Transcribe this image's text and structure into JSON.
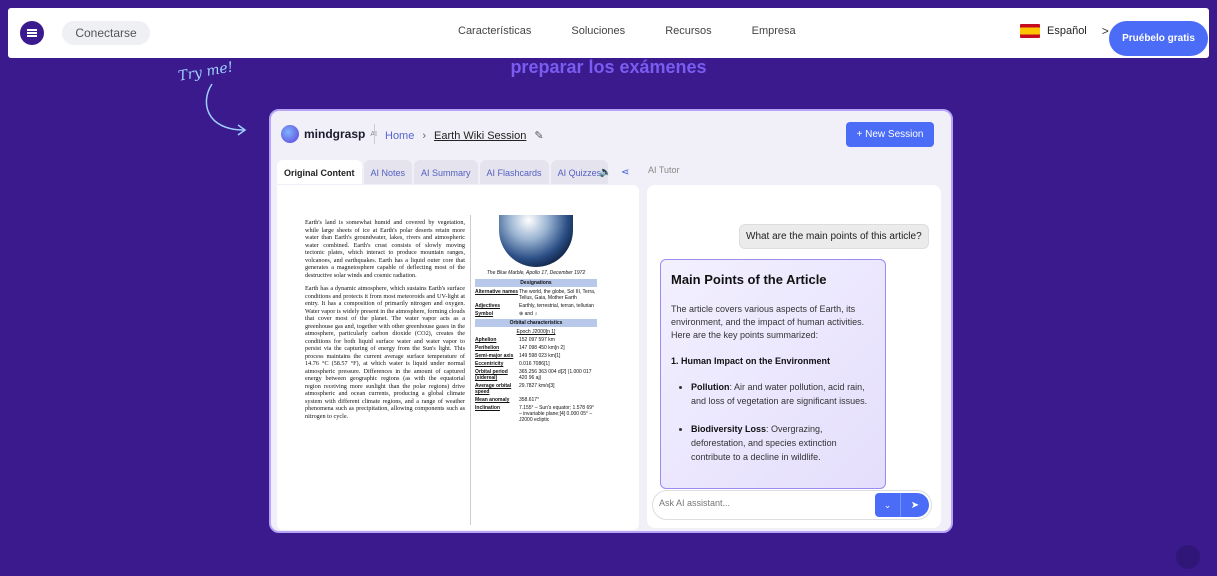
{
  "nav": {
    "login": "Conectarse",
    "links": [
      "Características",
      "Soluciones",
      "Recursos",
      "Empresa"
    ],
    "language": "Español",
    "cta": "Pruébelo gratis"
  },
  "hero": {
    "headline": "preparar los exámenes",
    "tryme": "Try me!"
  },
  "app": {
    "logo": "mindgrasp",
    "logo_sup": "AI",
    "breadcrumb_home": "Home",
    "breadcrumb_session": "Earth Wiki Session",
    "new_session": "+ New Session",
    "tabs": [
      "Original Content",
      "AI Notes",
      "AI Summary",
      "AI Flashcards",
      "AI Quizzes"
    ],
    "ai_tutor_label": "AI Tutor"
  },
  "document": {
    "para1": "Earth's land is somewhat humid and covered by vegetation, while large sheets of ice at Earth's polar deserts retain more water than Earth's groundwater, lakes, rivers and atmospheric water combined. Earth's crust consists of slowly moving tectonic plates, which interact to produce mountain ranges, volcanoes, and earthquakes. Earth has a liquid outer core that generates a magnetosphere capable of deflecting most of the destructive solar winds and cosmic radiation.",
    "para2": "Earth has a dynamic atmosphere, which sustains Earth's surface conditions and protects it from most meteoroids and UV-light at entry. It has a composition of primarily nitrogen and oxygen. Water vapor is widely present in the atmosphere, forming clouds that cover most of the planet. The water vapor acts as a greenhouse gas and, together with other greenhouse gases in the atmosphere, particularly carbon dioxide (CO2), creates the conditions for both liquid surface water and water vapor to persist via the capturing of energy from the Sun's light. This process maintains the current average surface temperature of 14.76 °C (58.57 °F), at which water is liquid under normal atmospheric pressure. Differences in the amount of captured energy between geographic regions (as with the equatorial region receiving more sunlight than the polar regions) drive atmospheric and ocean currents, producing a global climate system with different climate regions, and a range of weather phenomena such as precipitation, allowing components such as nitrogen to cycle.",
    "infobox": {
      "caption": "The Blue Marble, Apollo 17, December 1972",
      "designations_head": "Designations",
      "rows1": [
        {
          "k": "Alternative names",
          "v": "The world, the globe, Sol III, Terra, Tellus, Gaia, Mother Earth"
        },
        {
          "k": "Adjectives",
          "v": "Earthly, terrestrial, terran, tellurian"
        },
        {
          "k": "Symbol",
          "v": "⊕ and ♁"
        }
      ],
      "orbital_head": "Orbital characteristics",
      "epoch": "Epoch J2000[n 1]",
      "rows2": [
        {
          "k": "Aphelion",
          "v": "152 097 597 km"
        },
        {
          "k": "Perihelion",
          "v": "147 098 450 km[n 2]"
        },
        {
          "k": "Semi-major axis",
          "v": "149 598 023 km[1]"
        },
        {
          "k": "Eccentricity",
          "v": "0.016 7086[1]"
        },
        {
          "k": "Orbital period (sidereal)",
          "v": "365.256 363 004 d[2] (1.000 017 420 96 aj)"
        },
        {
          "k": "Average orbital speed",
          "v": "29.7827 km/s[3]"
        },
        {
          "k": "Mean anomaly",
          "v": "358.617°"
        },
        {
          "k": "Inclination",
          "v": "7.155° – Sun's equator; 1.578 69° – invariable plane;[4] 0.000 05° – J2000 ecliptic"
        }
      ]
    }
  },
  "chat": {
    "user_question": "What are the main points of this article?",
    "answer_title": "Main Points of the Article",
    "answer_intro": "The article covers various aspects of Earth, its environment, and the impact of human activities. Here are the key points summarized:",
    "section1": "1. Human Impact on the Environment",
    "bullets": [
      {
        "term": "Pollution",
        "text": ": Air and water pollution, acid rain, and loss of vegetation are significant issues."
      },
      {
        "term": "Biodiversity Loss",
        "text": ": Overgrazing, deforestation, and species extinction contribute to a decline in wildlife."
      }
    ],
    "input_placeholder": "Ask AI assistant..."
  },
  "colors": {
    "background": "#3a1a8c",
    "accent": "#4a6cf7",
    "headline": "#7a5cf0"
  }
}
